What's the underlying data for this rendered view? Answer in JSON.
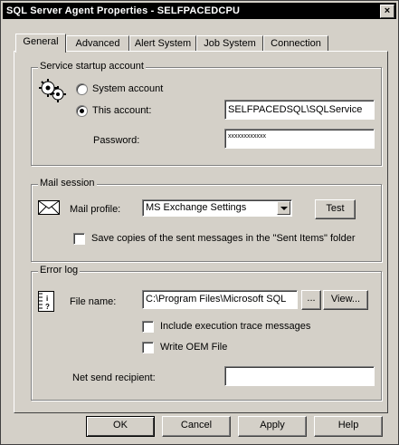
{
  "window": {
    "title": "SQL Server Agent Properties - SELFPACEDCPU",
    "close_label": "×"
  },
  "tabs": [
    {
      "label": "General"
    },
    {
      "label": "Advanced"
    },
    {
      "label": "Alert System"
    },
    {
      "label": "Job System"
    },
    {
      "label": "Connection"
    }
  ],
  "service_startup": {
    "group_label": "Service startup account",
    "system_account_label": "System account",
    "this_account_label": "This account:",
    "selected": "this_account",
    "account_value": "SELFPACEDSQL\\SQLService",
    "password_label": "Password:",
    "password_value": "xxxxxxxxxxxx"
  },
  "mail_session": {
    "group_label": "Mail session",
    "mail_profile_label": "Mail profile:",
    "mail_profile_value": "MS Exchange Settings",
    "test_label": "Test",
    "save_copies_label": "Save copies of the sent messages in the \"Sent Items\" folder",
    "save_copies_checked": false
  },
  "error_log": {
    "group_label": "Error log",
    "file_name_label": "File name:",
    "file_name_value": "C:\\Program Files\\Microsoft SQL",
    "browse_label": "...",
    "view_label": "View...",
    "include_trace_label": "Include execution trace messages",
    "include_trace_checked": false,
    "write_oem_label": "Write OEM File",
    "write_oem_checked": false,
    "net_send_label": "Net send recipient:",
    "net_send_value": ""
  },
  "footer": {
    "ok_label": "OK",
    "cancel_label": "Cancel",
    "apply_label": "Apply",
    "help_label": "Help"
  }
}
